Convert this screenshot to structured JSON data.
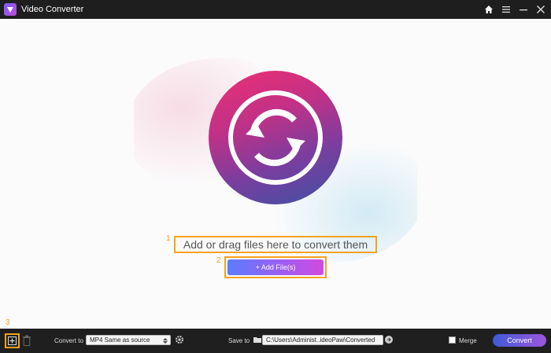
{
  "app": {
    "title": "Video Converter"
  },
  "main": {
    "hint": "Add or drag files here to convert them",
    "add_button_label": "+ Add File(s)",
    "annotations": [
      "1",
      "2",
      "3"
    ]
  },
  "bottom": {
    "convert_to_label": "Convert to",
    "format_value": "MP4 Same as source",
    "save_to_label": "Save to",
    "path_value": "C:\\Users\\Administ..ideoPaw\\Converted",
    "merge_label": "Merge",
    "convert_label": "Convert"
  },
  "colors": {
    "annotation": "#f5a21b",
    "titlebar": "#1e1e1e",
    "bottombar": "#1f1f1f",
    "accent": "#9b56e0"
  },
  "icons": [
    "app-logo-icon",
    "home-icon",
    "menu-icon",
    "minimize-icon",
    "close-icon",
    "convert-arrows-icon",
    "add-file-icon",
    "trash-icon",
    "gear-icon",
    "folder-icon",
    "arrow-right-icon"
  ]
}
